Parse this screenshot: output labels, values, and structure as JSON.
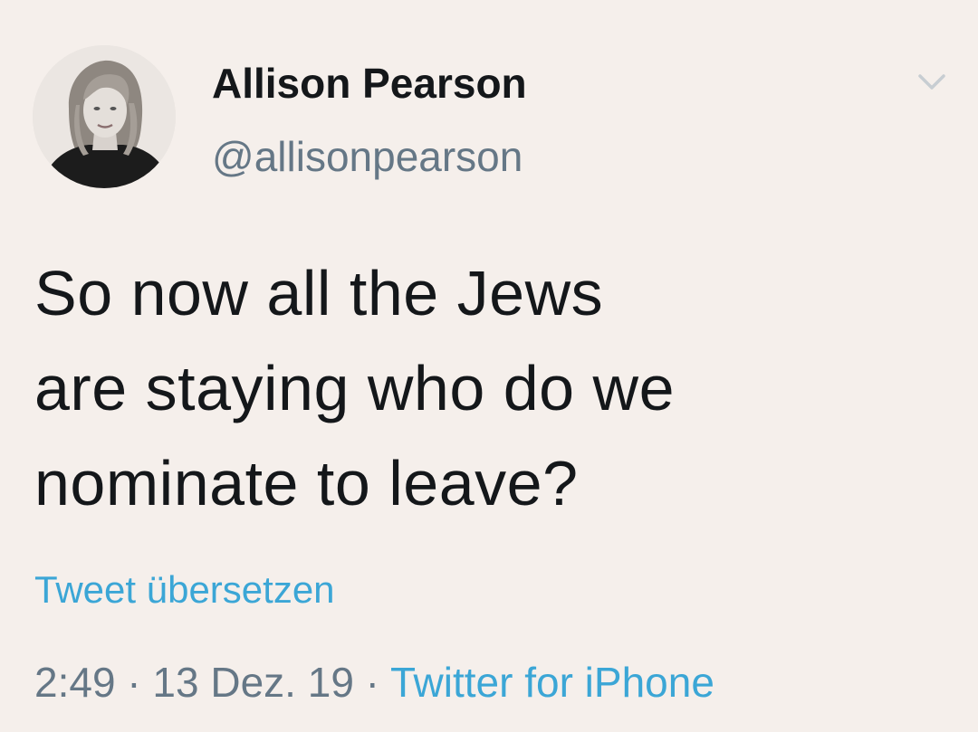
{
  "tweet": {
    "author": {
      "display_name": "Allison Pearson",
      "handle": "@allisonpearson"
    },
    "text_lines": [
      "So now all the Jews",
      "are staying who do we",
      "nominate to leave?"
    ],
    "translate_label": "Tweet übersetzen",
    "meta": {
      "time": "2:49",
      "separator": " · ",
      "date": "13 Dez. 19",
      "source": "Twitter for iPhone"
    }
  },
  "icons": {
    "menu": "chevron-down-icon",
    "avatar": "profile-photo"
  },
  "colors": {
    "background": "#f5efeb",
    "text": "#14171a",
    "secondary": "#657786",
    "link": "#3ba6d6"
  }
}
